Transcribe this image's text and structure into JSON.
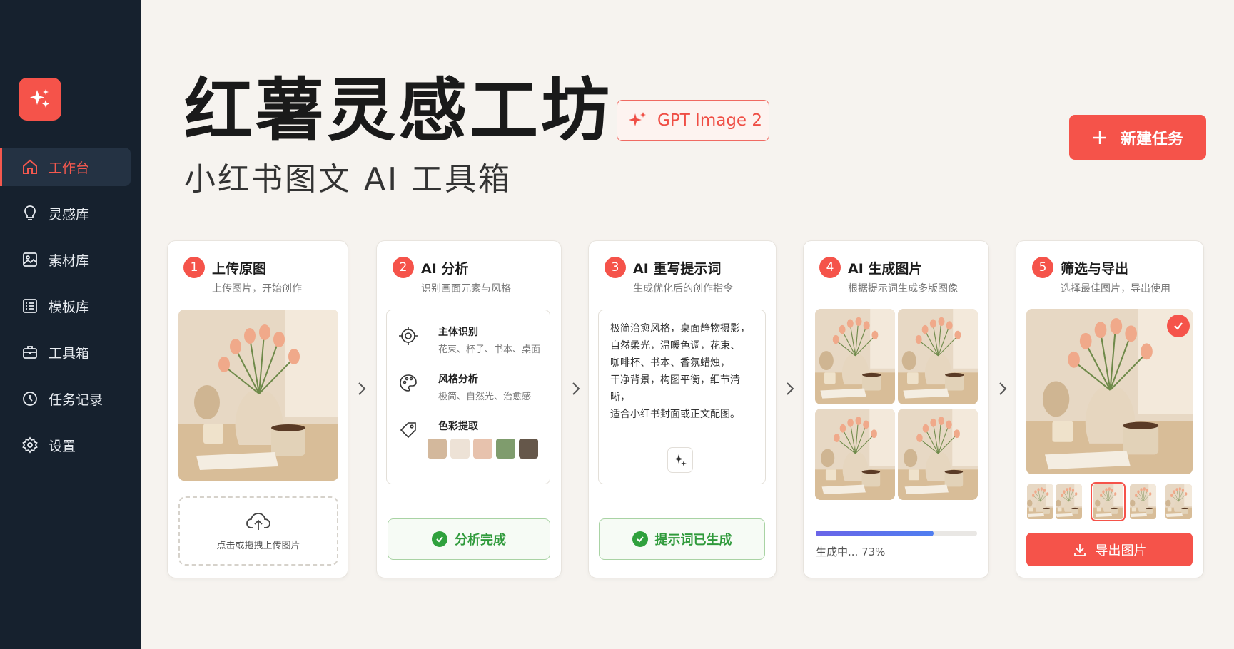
{
  "brand": {
    "accent": "#f5534a",
    "sidebar_bg": "#16212e",
    "page_bg": "#f6f3ef"
  },
  "sidebar": {
    "logo_icon": "sparkle-icon",
    "items": [
      {
        "label": "工作台",
        "icon": "home-icon",
        "active": true
      },
      {
        "label": "灵感库",
        "icon": "lightbulb-icon"
      },
      {
        "label": "素材库",
        "icon": "image-icon"
      },
      {
        "label": "模板库",
        "icon": "list-icon"
      },
      {
        "label": "工具箱",
        "icon": "toolbox-icon"
      },
      {
        "label": "任务记录",
        "icon": "clock-icon"
      },
      {
        "label": "设置",
        "icon": "gear-icon"
      }
    ]
  },
  "header": {
    "title": "红薯灵感工坊",
    "subtitle": "小红书图文 AI 工具箱",
    "badge": "GPT Image 2",
    "new_task": "新建任务"
  },
  "steps": [
    {
      "num": "1",
      "title": "上传原图",
      "desc": "上传图片，开始创作",
      "upload_hint": "点击或拖拽上传图片"
    },
    {
      "num": "2",
      "title": "AI 分析",
      "desc": "识别画面元素与风格",
      "attributes": [
        {
          "label": "主体识别",
          "value": "花束、杯子、书本、桌面",
          "icon": "target-icon"
        },
        {
          "label": "风格分析",
          "value": "极简、自然光、治愈感",
          "icon": "palette-icon"
        },
        {
          "label": "色彩提取",
          "value": "",
          "icon": "tag-icon"
        }
      ],
      "swatches": [
        "#d3b89c",
        "#ede2d6",
        "#e7c2ad",
        "#7f9c6d",
        "#65574a"
      ],
      "status": "分析完成"
    },
    {
      "num": "3",
      "title": "AI 重写提示词",
      "desc": "生成优化后的创作指令",
      "prompt_lines": [
        "极简治愈风格，桌面静物摄影，",
        "自然柔光，温暖色调，花束、",
        "咖啡杯、书本、香氛蜡烛，",
        "干净背景，构图平衡，细节清晰，",
        "适合小红书封面或正文配图。"
      ],
      "status": "提示词已生成"
    },
    {
      "num": "4",
      "title": "AI 生成图片",
      "desc": "根据提示词生成多版图像",
      "progress": 0.73,
      "progress_label": "生成中... 73%"
    },
    {
      "num": "5",
      "title": "筛选与导出",
      "desc": "选择最佳图片，导出使用",
      "selected_thumb": 2,
      "export_label": "导出图片"
    }
  ]
}
